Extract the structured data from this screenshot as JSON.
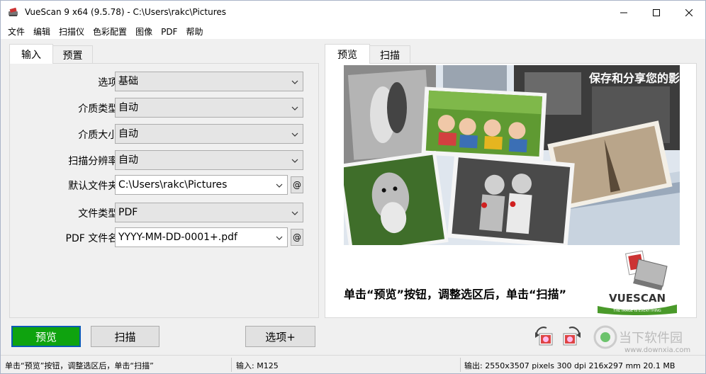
{
  "window": {
    "title": "VueScan 9 x64 (9.5.78) - C:\\Users\\rakc\\Pictures"
  },
  "menu": [
    "文件",
    "编辑",
    "扫描仪",
    "色彩配置",
    "图像",
    "PDF",
    "帮助"
  ],
  "left_tabs": [
    "输入",
    "预置"
  ],
  "right_tabs": [
    "预览",
    "扫描"
  ],
  "form": {
    "options_label": "选项:",
    "options_value": "基础",
    "media_type_label": "介质类型:",
    "media_type_value": "自动",
    "media_size_label": "介质大小:",
    "media_size_value": "自动",
    "scan_res_label": "扫描分辨率:",
    "scan_res_value": "自动",
    "default_folder_label": "默认文件夹:",
    "default_folder_value": "C:\\Users\\rakc\\Pictures",
    "file_type_label": "文件类型:",
    "file_type_value": "PDF",
    "pdf_name_label": "PDF 文件名:",
    "pdf_name_value": "YYYY-MM-DD-0001+.pdf",
    "at_symbol": "@"
  },
  "preview": {
    "headline": "保存和分享您的影像",
    "instruction": "单击“预览”按钮，调整选区后，单击“扫描”",
    "logo_text": "VUESCAN",
    "logo_tagline": "THE IMAGE IS EVERYTHING"
  },
  "buttons": {
    "preview": "预览",
    "scan": "扫描",
    "options": "选项+"
  },
  "status": {
    "hint": "单击“预览”按钮，调整选区后，单击“扫描”",
    "input": "输入: M125",
    "output": "输出: 2550x3507 pixels 300 dpi 216x297 mm 20.1 MB"
  },
  "watermark": {
    "text": "当下软件园",
    "url": "www.downxia.com"
  },
  "colors": {
    "preview_button": "#0fa30f",
    "accent_border": "#0a5bb5",
    "logo_green": "#4a9a2a"
  }
}
